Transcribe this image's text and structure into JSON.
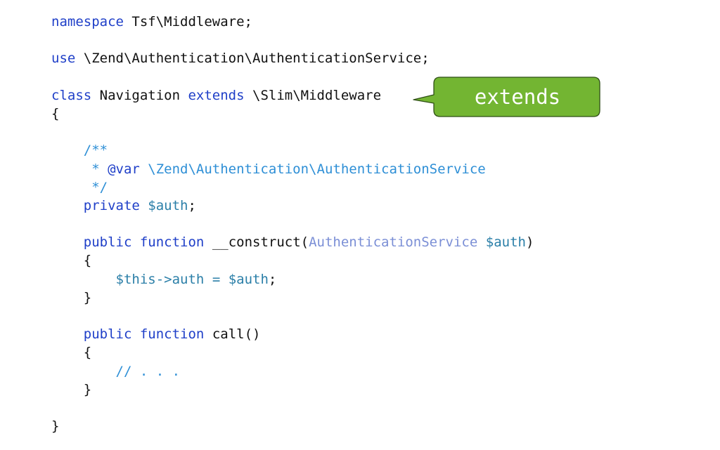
{
  "code": {
    "lines": [
      [
        {
          "t": "namespace",
          "k": "keyword"
        },
        {
          "t": " Tsf\\Middleware;",
          "k": "plain"
        }
      ],
      [],
      [
        {
          "t": "use",
          "k": "keyword"
        },
        {
          "t": " \\Zend\\Authentication\\AuthenticationService;",
          "k": "plain"
        }
      ],
      [],
      [
        {
          "t": "class",
          "k": "keyword"
        },
        {
          "t": " Navigation ",
          "k": "plain"
        },
        {
          "t": "extends",
          "k": "keyword"
        },
        {
          "t": " \\Slim\\Middleware",
          "k": "plain"
        }
      ],
      [
        {
          "t": "{",
          "k": "plain"
        }
      ],
      [],
      [
        {
          "t": "    /**",
          "k": "comment"
        }
      ],
      [
        {
          "t": "     * ",
          "k": "comment"
        },
        {
          "t": "@var",
          "k": "keyword"
        },
        {
          "t": " \\Zend\\Authentication\\AuthenticationService",
          "k": "comment"
        }
      ],
      [
        {
          "t": "     */",
          "k": "comment"
        }
      ],
      [
        {
          "t": "    ",
          "k": "plain"
        },
        {
          "t": "private",
          "k": "keyword"
        },
        {
          "t": " ",
          "k": "plain"
        },
        {
          "t": "$auth",
          "k": "variable"
        },
        {
          "t": ";",
          "k": "plain"
        }
      ],
      [],
      [
        {
          "t": "    ",
          "k": "plain"
        },
        {
          "t": "public",
          "k": "keyword"
        },
        {
          "t": " ",
          "k": "plain"
        },
        {
          "t": "function",
          "k": "keyword"
        },
        {
          "t": " __construct(",
          "k": "plain"
        },
        {
          "t": "AuthenticationService",
          "k": "type"
        },
        {
          "t": " ",
          "k": "plain"
        },
        {
          "t": "$auth",
          "k": "variable"
        },
        {
          "t": ")",
          "k": "plain"
        }
      ],
      [
        {
          "t": "    {",
          "k": "plain"
        }
      ],
      [
        {
          "t": "        ",
          "k": "plain"
        },
        {
          "t": "$this",
          "k": "variable"
        },
        {
          "t": "->",
          "k": "variable"
        },
        {
          "t": "auth",
          "k": "variable"
        },
        {
          "t": " = ",
          "k": "variable"
        },
        {
          "t": "$auth",
          "k": "variable"
        },
        {
          "t": ";",
          "k": "plain"
        }
      ],
      [
        {
          "t": "    }",
          "k": "plain"
        }
      ],
      [],
      [
        {
          "t": "    ",
          "k": "plain"
        },
        {
          "t": "public",
          "k": "keyword"
        },
        {
          "t": " ",
          "k": "plain"
        },
        {
          "t": "function",
          "k": "keyword"
        },
        {
          "t": " call()",
          "k": "plain"
        }
      ],
      [
        {
          "t": "    {",
          "k": "plain"
        }
      ],
      [
        {
          "t": "        // . . .",
          "k": "comment"
        }
      ],
      [
        {
          "t": "    }",
          "k": "plain"
        }
      ],
      [],
      [
        {
          "t": "}",
          "k": "plain"
        }
      ]
    ]
  },
  "callout": {
    "label": "extends",
    "fill_color": "#73b532",
    "border_color": "#2f4f16",
    "text_color": "#ffffff"
  },
  "colors": {
    "keyword": "#1f3fc8",
    "comment": "#2e8fd6",
    "variable": "#2b7fa8",
    "type": "#7b8fd6",
    "plain": "#111111"
  }
}
